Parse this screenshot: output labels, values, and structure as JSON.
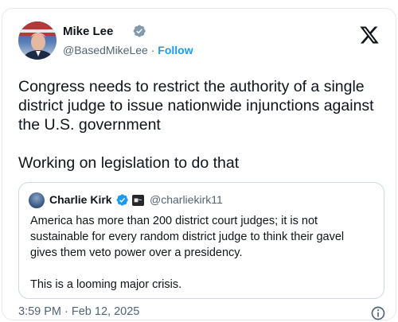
{
  "author": {
    "name": "Mike Lee",
    "handle": "@BasedMikeLee",
    "separator": "·",
    "follow_label": "Follow",
    "verified_color": "#829aab"
  },
  "post": {
    "text": "Congress needs to restrict the authority of a single district judge to issue nationwide injunctions against the U.S. government\n\nWorking on legislation to do that",
    "timestamp": "3:59 PM · Feb 12, 2025"
  },
  "quoted": {
    "name": "Charlie Kirk",
    "handle": "@charliekirk11",
    "affiliate_badge": "■~",
    "verified_color": "#1d9bf0",
    "text": "America has more than 200 district court judges; it is not sustainable for every random district judge to think their gavel gives them veto power over a presidency.\n\nThis is a looming major crisis."
  },
  "icons": {
    "logo": "x-logo-icon",
    "verified": "verified-badge-icon",
    "info": "info-icon"
  },
  "colors": {
    "accent": "#1d9bf0",
    "text": "#0f1419",
    "muted": "#536471",
    "border": "#cfd9de"
  }
}
